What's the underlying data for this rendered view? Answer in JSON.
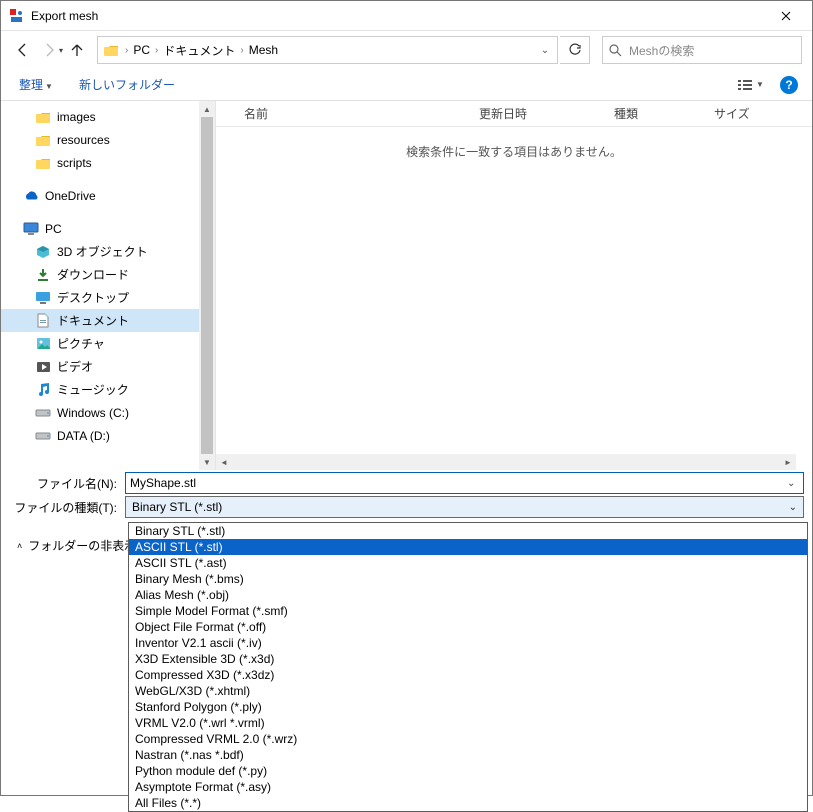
{
  "title": "Export mesh",
  "breadcrumbs": {
    "pc": "PC",
    "docs": "ドキュメント",
    "mesh": "Mesh"
  },
  "search": {
    "placeholder": "Meshの検索"
  },
  "toolbar": {
    "organize": "整理",
    "newfolder": "新しいフォルダー"
  },
  "columns": {
    "name": "名前",
    "date": "更新日時",
    "type": "種類",
    "size": "サイズ"
  },
  "empty_msg": "検索条件に一致する項目はありません。",
  "sidebar": {
    "items": [
      {
        "label": "images",
        "icon": "folder"
      },
      {
        "label": "resources",
        "icon": "folder"
      },
      {
        "label": "scripts",
        "icon": "folder"
      },
      {
        "label": "OneDrive",
        "icon": "onedrive",
        "lvl0": true,
        "gapbefore": true
      },
      {
        "label": "PC",
        "icon": "pc",
        "lvl0": true,
        "gapbefore": true
      },
      {
        "label": "3D オブジェクト",
        "icon": "cube"
      },
      {
        "label": "ダウンロード",
        "icon": "download"
      },
      {
        "label": "デスクトップ",
        "icon": "desktop"
      },
      {
        "label": "ドキュメント",
        "icon": "document",
        "selected": true
      },
      {
        "label": "ピクチャ",
        "icon": "picture"
      },
      {
        "label": "ビデオ",
        "icon": "video"
      },
      {
        "label": "ミュージック",
        "icon": "music"
      },
      {
        "label": "Windows (C:)",
        "icon": "drive"
      },
      {
        "label": "DATA (D:)",
        "icon": "drive"
      }
    ]
  },
  "fields": {
    "filename_label": "ファイル名(N):",
    "filename_value": "MyShape.stl",
    "filetype_label": "ファイルの種類(T):",
    "filetype_value": "Binary STL (*.stl)",
    "hide_folders": "フォルダーの非表示"
  },
  "dropdown": {
    "options": [
      "Binary STL (*.stl)",
      "ASCII STL (*.stl)",
      "ASCII STL (*.ast)",
      "Binary Mesh (*.bms)",
      "Alias Mesh (*.obj)",
      "Simple Model Format (*.smf)",
      "Object File Format (*.off)",
      "Inventor V2.1 ascii (*.iv)",
      "X3D Extensible 3D (*.x3d)",
      "Compressed X3D (*.x3dz)",
      "WebGL/X3D (*.xhtml)",
      "Stanford Polygon (*.ply)",
      "VRML V2.0 (*.wrl *.vrml)",
      "Compressed VRML 2.0 (*.wrz)",
      "Nastran (*.nas *.bdf)",
      "Python module def (*.py)",
      "Asymptote Format (*.asy)",
      "All Files (*.*)"
    ],
    "selected_index": 1
  }
}
